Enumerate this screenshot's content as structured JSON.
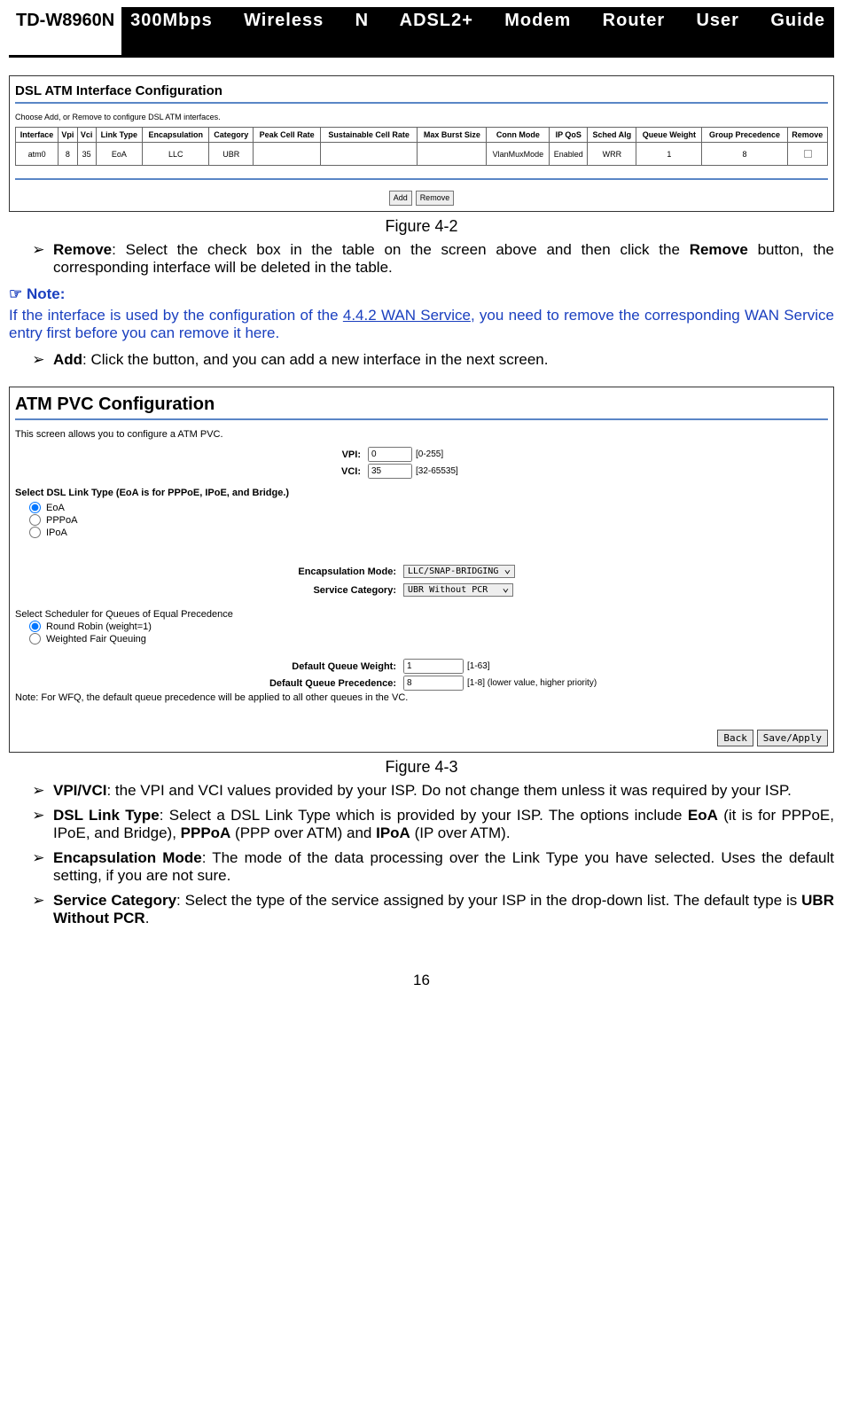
{
  "header": {
    "model": "TD-W8960N",
    "title": "300Mbps Wireless N ADSL2+ Modem Router User Guide"
  },
  "fig1": {
    "title": "DSL ATM Interface Configuration",
    "instr": "Choose Add, or Remove to configure DSL ATM interfaces.",
    "cols": [
      "Interface",
      "Vpi",
      "Vci",
      "Link Type",
      "Encapsulation",
      "Category",
      "Peak Cell Rate",
      "Sustainable Cell Rate",
      "Max Burst Size",
      "Conn Mode",
      "IP QoS",
      "Sched Alg",
      "Queue Weight",
      "Group Precedence",
      "Remove"
    ],
    "row": [
      "atm0",
      "8",
      "35",
      "EoA",
      "LLC",
      "UBR",
      "",
      "",
      "",
      "VlanMuxMode",
      "Enabled",
      "WRR",
      "1",
      "8",
      ""
    ],
    "add": "Add",
    "remove": "Remove",
    "caption": "Figure 4-2"
  },
  "bullets1": [
    {
      "b": "Remove",
      "t": ": Select the check box in the table on the screen above and then click the ",
      "b2": "Remove",
      "t2": " button, the corresponding interface will be deleted in the table."
    }
  ],
  "note": {
    "head": "☞ Note:",
    "pre": "If the interface is used by the configuration of the ",
    "link": "4.4.2 WAN Service",
    "post": ", you need to remove the corresponding WAN Service entry first before you can remove it here."
  },
  "bullets2": [
    {
      "b": "Add",
      "t": ": Click the button, and you can add a new interface in the next screen."
    }
  ],
  "fig2": {
    "title": "ATM PVC Configuration",
    "intro": "This screen allows you to configure a ATM PVC.",
    "vpi_lbl": "VPI:",
    "vpi_val": "0",
    "vpi_range": "[0-255]",
    "vci_lbl": "VCI:",
    "vci_val": "35",
    "vci_range": "[32-65535]",
    "linktype_head": "Select DSL Link Type (EoA is for PPPoE, IPoE, and Bridge.)",
    "opt_eoa": "EoA",
    "opt_pppoa": "PPPoA",
    "opt_ipoa": "IPoA",
    "encap_lbl": "Encapsulation Mode:",
    "encap_val": "LLC/SNAP-BRIDGING",
    "svc_lbl": "Service Category:",
    "svc_val": "UBR Without PCR",
    "sched_head": "Select Scheduler for Queues of Equal Precedence",
    "opt_rr": "Round Robin (weight=1)",
    "opt_wfq": "Weighted Fair Queuing",
    "qw_lbl": "Default Queue Weight:",
    "qw_val": "1",
    "qw_range": "[1-63]",
    "qp_lbl": "Default Queue Precedence:",
    "qp_val": "8",
    "qp_range": "[1-8] (lower value, higher priority)",
    "wfq_note": "Note: For WFQ, the default queue precedence will be applied to all other queues in the VC.",
    "back": "Back",
    "save": "Save/Apply",
    "caption": "Figure 4-3"
  },
  "bullets3": [
    {
      "b": "VPI/VCI",
      "t": ": the VPI and VCI values provided by your ISP. Do not change them unless it was required by your ISP."
    },
    {
      "b": "DSL Link Type",
      "t": ": Select a DSL Link Type which is provided by your ISP. The options include ",
      "b2": "EoA",
      "t2": " (it is for PPPoE, IPoE, and Bridge), ",
      "b3": "PPPoA",
      "t3": " (PPP over ATM) and ",
      "b4": "IPoA",
      "t4": " (IP over ATM)."
    },
    {
      "b": "Encapsulation Mode",
      "t": ": The mode of the data processing over the Link Type you have selected. Uses the default setting, if you are not sure."
    },
    {
      "b": "Service Category",
      "t": ": Select the type of the service assigned by your ISP in the drop-down list. The default type is ",
      "b2": "UBR Without PCR",
      "t2": "."
    }
  ],
  "page": "16"
}
